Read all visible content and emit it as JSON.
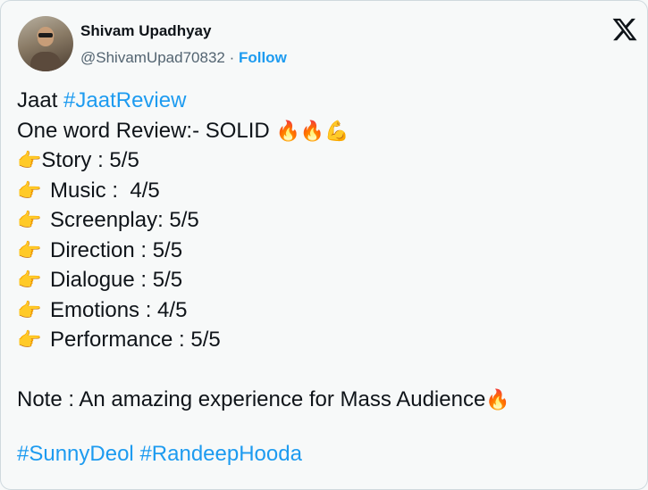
{
  "author": {
    "name": "Shivam Upadhyay",
    "handle": "@ShivamUpad70832",
    "separator": " · ",
    "follow_label": "Follow"
  },
  "brand": {
    "logo": "x-logo-icon"
  },
  "tweet": {
    "line1_text": "Jaat ",
    "line1_tag": "#JaatReview",
    "line2_text": "One word Review:- SOLID ",
    "line2_emoji": "🔥🔥💪",
    "pointer_emoji": "👉",
    "ratings": [
      "Story : 5/5",
      "Music :  4/5",
      "Screenplay: 5/5",
      "Direction : 5/5",
      "Dialogue : 5/5",
      "Emotions : 4/5",
      "Performance : 5/5"
    ],
    "note_text": "Note : An amazing experience for Mass Audience",
    "note_emoji": "🔥",
    "tag1": "#SunnyDeol",
    "tag2": "#RandeepHooda"
  },
  "colors": {
    "link": "#1d9bf0",
    "text": "#0f1419",
    "muted": "#536471",
    "background": "#f7f9f9"
  }
}
